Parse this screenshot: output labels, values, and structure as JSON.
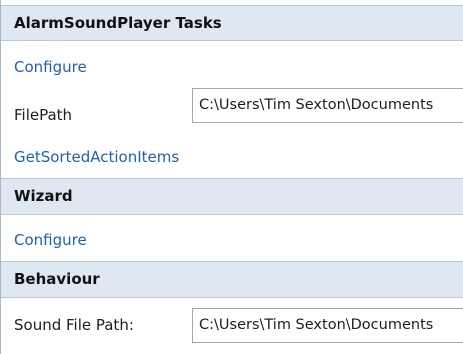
{
  "sections": [
    {
      "title": "AlarmSoundPlayer Tasks",
      "configure_label": "Configure",
      "filepath_label": "FilePath",
      "filepath_value": "C:\\Users\\Tim Sexton\\Documents",
      "sorted_items_label": "GetSortedActionItems"
    },
    {
      "title": "Wizard",
      "configure_label": "Configure"
    },
    {
      "title": "Behaviour",
      "sound_file_path_label": "Sound File Path:",
      "sound_file_path_value": "C:\\Users\\Tim Sexton\\Documents"
    }
  ]
}
